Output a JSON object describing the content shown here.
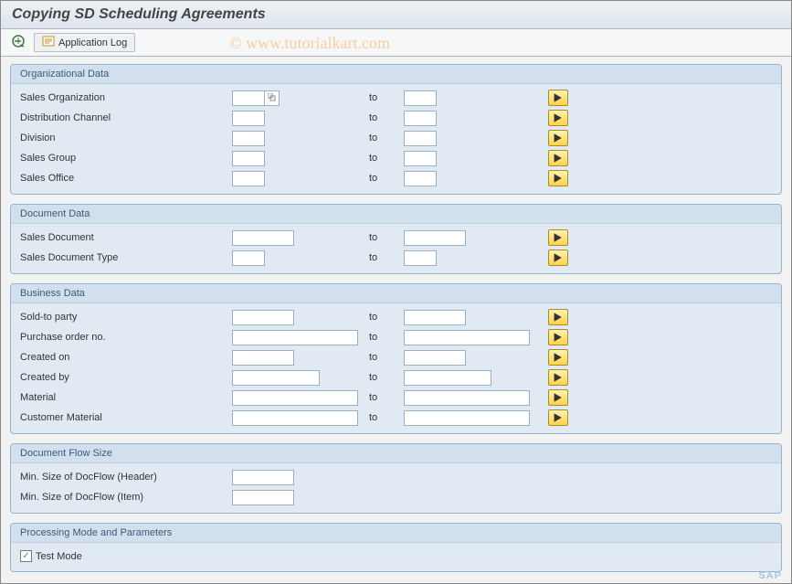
{
  "title": "Copying SD Scheduling Agreements",
  "toolbar": {
    "execute_icon": "execute-icon",
    "log_icon": "log-icon",
    "app_log_label": "Application Log"
  },
  "to_label": "to",
  "groups": {
    "org": {
      "title": "Organizational Data",
      "fields": {
        "sales_org": {
          "label": "Sales Organization",
          "from": "",
          "to": ""
        },
        "dist_channel": {
          "label": "Distribution Channel",
          "from": "",
          "to": ""
        },
        "division": {
          "label": "Division",
          "from": "",
          "to": ""
        },
        "sales_group": {
          "label": "Sales Group",
          "from": "",
          "to": ""
        },
        "sales_office": {
          "label": "Sales Office",
          "from": "",
          "to": ""
        }
      }
    },
    "doc": {
      "title": "Document Data",
      "fields": {
        "sales_doc": {
          "label": "Sales Document",
          "from": "",
          "to": ""
        },
        "sales_doc_type": {
          "label": "Sales Document Type",
          "from": "",
          "to": ""
        }
      }
    },
    "biz": {
      "title": "Business Data",
      "fields": {
        "sold_to": {
          "label": "Sold-to party",
          "from": "",
          "to": ""
        },
        "purchase_order": {
          "label": "Purchase order no.",
          "from": "",
          "to": ""
        },
        "created_on": {
          "label": "Created on",
          "from": "",
          "to": ""
        },
        "created_by": {
          "label": "Created by",
          "from": "",
          "to": ""
        },
        "material": {
          "label": "Material",
          "from": "",
          "to": ""
        },
        "cust_material": {
          "label": "Customer Material",
          "from": "",
          "to": ""
        }
      }
    },
    "flow": {
      "title": "Document Flow Size",
      "fields": {
        "header": {
          "label": "Min. Size of DocFlow (Header)",
          "value": ""
        },
        "item": {
          "label": "Min. Size of DocFlow (Item)",
          "value": ""
        }
      }
    },
    "proc": {
      "title": "Processing Mode and Parameters",
      "test_mode": {
        "label": "Test Mode",
        "checked": true
      }
    }
  },
  "watermark": "© www.tutorialkart.com"
}
